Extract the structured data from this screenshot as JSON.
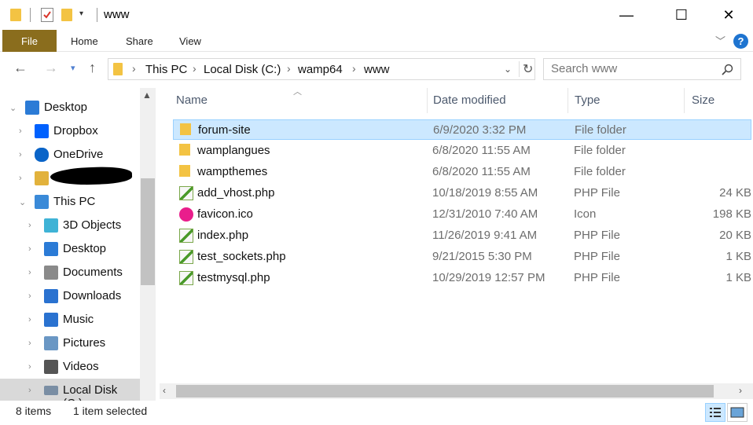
{
  "window": {
    "title": "www",
    "minimize": "—",
    "maximize": "☐",
    "close": "✕"
  },
  "ribbon": {
    "file": "File",
    "tabs": [
      "Home",
      "Share",
      "View"
    ],
    "help": "?"
  },
  "address": {
    "crumbs": [
      "This PC",
      "Local Disk (C:)",
      "wamp64",
      "www"
    ]
  },
  "search": {
    "placeholder": "Search www"
  },
  "nav": {
    "items": [
      {
        "label": "Desktop",
        "icon": "desktop-icon",
        "indent": 0
      },
      {
        "label": "Dropbox",
        "icon": "dropbox-icon",
        "indent": 1
      },
      {
        "label": "OneDrive",
        "icon": "onedrive-icon",
        "indent": 1
      },
      {
        "label": "",
        "icon": "user-folder-icon",
        "indent": 1
      },
      {
        "label": "This PC",
        "icon": "pc-icon",
        "indent": 1
      },
      {
        "label": "3D Objects",
        "icon": "3d-objects-icon",
        "indent": 2
      },
      {
        "label": "Desktop",
        "icon": "desktop-icon",
        "indent": 2
      },
      {
        "label": "Documents",
        "icon": "documents-icon",
        "indent": 2
      },
      {
        "label": "Downloads",
        "icon": "downloads-icon",
        "indent": 2
      },
      {
        "label": "Music",
        "icon": "music-icon",
        "indent": 2
      },
      {
        "label": "Pictures",
        "icon": "pictures-icon",
        "indent": 2
      },
      {
        "label": "Videos",
        "icon": "videos-icon",
        "indent": 2
      },
      {
        "label": "Local Disk (C:)",
        "icon": "local-disk-icon",
        "indent": 2
      }
    ]
  },
  "columns": {
    "name": "Name",
    "date": "Date modified",
    "type": "Type",
    "size": "Size"
  },
  "files": [
    {
      "name": "forum-site",
      "date": "6/9/2020 3:32 PM",
      "type": "File folder",
      "size": "",
      "icon": "folder-icon",
      "selected": true
    },
    {
      "name": "wamplangues",
      "date": "6/8/2020 11:55 AM",
      "type": "File folder",
      "size": "",
      "icon": "folder-icon",
      "selected": false
    },
    {
      "name": "wampthemes",
      "date": "6/8/2020 11:55 AM",
      "type": "File folder",
      "size": "",
      "icon": "folder-icon",
      "selected": false
    },
    {
      "name": "add_vhost.php",
      "date": "10/18/2019 8:55 AM",
      "type": "PHP File",
      "size": "24 KB",
      "icon": "php-file-icon",
      "selected": false
    },
    {
      "name": "favicon.ico",
      "date": "12/31/2010 7:40 AM",
      "type": "Icon",
      "size": "198 KB",
      "icon": "wamp-icon",
      "selected": false
    },
    {
      "name": "index.php",
      "date": "11/26/2019 9:41 AM",
      "type": "PHP File",
      "size": "20 KB",
      "icon": "php-file-icon",
      "selected": false
    },
    {
      "name": "test_sockets.php",
      "date": "9/21/2015 5:30 PM",
      "type": "PHP File",
      "size": "1 KB",
      "icon": "php-file-icon",
      "selected": false
    },
    {
      "name": "testmysql.php",
      "date": "10/29/2019 12:57 PM",
      "type": "PHP File",
      "size": "1 KB",
      "icon": "php-file-icon",
      "selected": false
    }
  ],
  "status": {
    "count": "8 items",
    "selection": "1 item selected"
  },
  "colors": {
    "selection": "#cce8ff",
    "selection_border": "#99d1ff",
    "file_tab": "#8a6d1d",
    "folder": "#f3c343",
    "accent": "#1e74d0"
  }
}
